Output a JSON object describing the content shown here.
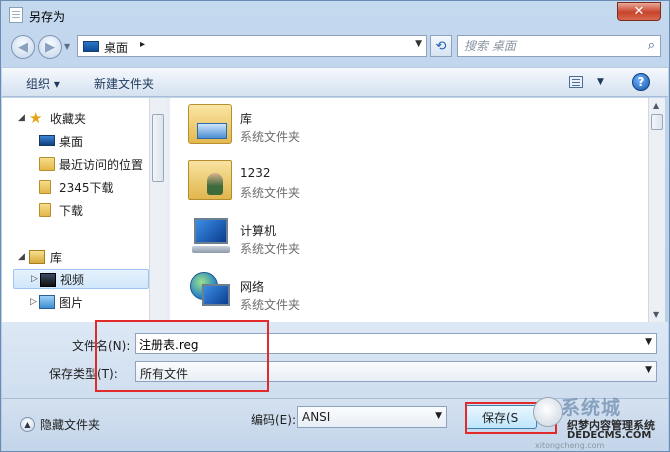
{
  "window": {
    "title": "另存为",
    "close_label": "✕"
  },
  "address_bar": {
    "crumb": "桌面",
    "crumb_arrow": "▸",
    "search_placeholder": "搜索 桌面"
  },
  "toolbar": {
    "organize": "组织 ▾",
    "new_folder": "新建文件夹",
    "help": "?"
  },
  "nav_pane": {
    "favorites": "收藏夹",
    "items": [
      "桌面",
      "最近访问的位置",
      "2345下载",
      "下载"
    ],
    "libraries": "库",
    "lib_items": [
      "视频",
      "图片"
    ]
  },
  "files": [
    {
      "name": "库",
      "type": "系统文件夹"
    },
    {
      "name": "1232",
      "type": "系统文件夹"
    },
    {
      "name": "计算机",
      "type": "系统文件夹"
    },
    {
      "name": "网络",
      "type": "系统文件夹"
    }
  ],
  "form": {
    "filename_label": "文件名(N):",
    "filename_value": "注册表.reg",
    "savetype_label": "保存类型(T):",
    "savetype_value": "所有文件"
  },
  "bottom": {
    "hide_folders": "隐藏文件夹",
    "encoding_label": "编码(E):",
    "encoding_value": "ANSI",
    "save_button": "保存(S"
  },
  "watermark": {
    "big_text": "系统城",
    "cn_text": "织梦内容管理系统",
    "url": "DEDECMS.COM",
    "small": "xitongcheng.com"
  },
  "colors": {
    "annotation": "#e22a2a",
    "window_frame": "#b3cbe6"
  }
}
